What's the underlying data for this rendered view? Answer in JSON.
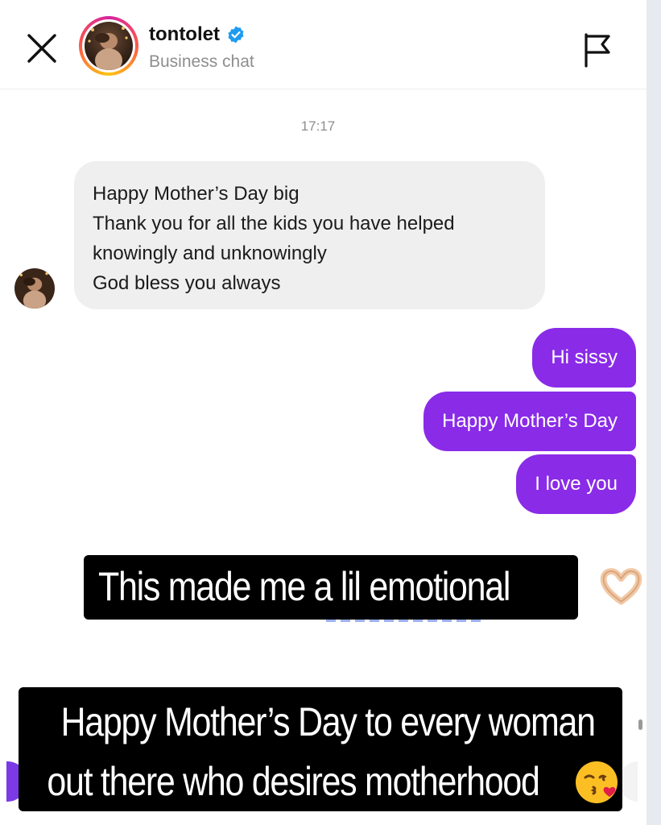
{
  "header": {
    "username": "tontolet",
    "subtitle": "Business chat",
    "verified": true,
    "ring_colors": [
      "#d6249f",
      "#fd5949",
      "#fdc50f"
    ]
  },
  "thread": {
    "timestamp": "17:17",
    "incoming": {
      "lines": [
        "Happy Mother’s Day big",
        "Thank you for all the kids you have helped",
        "knowingly and unknowingly",
        "God bless you always"
      ]
    },
    "outgoing": [
      {
        "text": "Hi sissy"
      },
      {
        "text": "Happy Mother’s Day"
      },
      {
        "text": "I love you"
      }
    ],
    "outgoing_color": "#8a2be8",
    "incoming_color": "#efefef"
  },
  "overlays": {
    "caption1": "This made me a lil emotional",
    "caption1_emoji": "heart-hands-emoji",
    "caption2_line1": "Happy Mother’s Day to every woman",
    "caption2_line2": "out there who desires motherhood",
    "caption2_emoji": "kissing-face-emoji"
  },
  "icons": {
    "close": "close-icon",
    "report": "flag-icon",
    "verified": "verified-badge-icon"
  }
}
